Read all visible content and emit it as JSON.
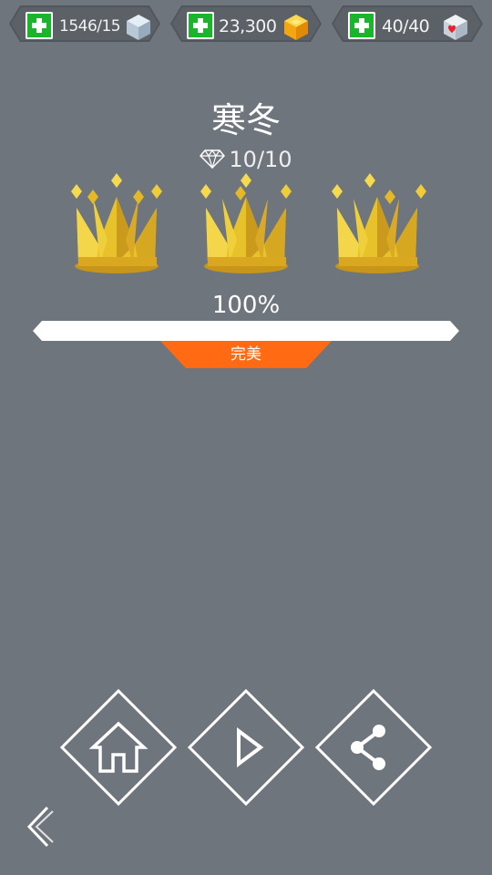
{
  "currency_bar": {
    "cubes": {
      "value": "1546/15",
      "icon": "cube-icon"
    },
    "coins": {
      "value": "23,300",
      "icon": "gold-cube-icon"
    },
    "hearts": {
      "value": "40/40",
      "icon": "heart-cube-icon"
    }
  },
  "level": {
    "title": "寒冬",
    "gems": "10/10",
    "crowns_earned": 3,
    "crowns_total": 3
  },
  "progress": {
    "percent_text": "100%",
    "value": 1.0,
    "rating": "完美"
  },
  "colors": {
    "background": "#6f757c",
    "accent_orange": "#ff6a13",
    "plus_green": "#1bb52b",
    "crown_gold": "#e8c22a"
  },
  "buttons": [
    "home-icon",
    "play-icon",
    "share-icon"
  ]
}
